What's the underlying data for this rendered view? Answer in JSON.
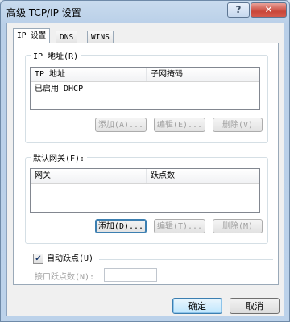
{
  "window": {
    "title": "高级 TCP/IP 设置",
    "help_label": "?",
    "close_label": "✕"
  },
  "tabs": [
    {
      "label": "IP 设置",
      "active": true
    },
    {
      "label": "DNS",
      "active": false
    },
    {
      "label": "WINS",
      "active": false
    }
  ],
  "ip_group": {
    "legend": "IP 地址(R)",
    "columns": [
      "IP 地址",
      "子网掩码"
    ],
    "rows": [
      "已启用 DHCP"
    ],
    "buttons": {
      "add": "添加(A)...",
      "edit": "编辑(E)...",
      "remove": "删除(V)"
    }
  },
  "gateway_group": {
    "legend": "默认网关(F):",
    "columns": [
      "网关",
      "跃点数"
    ],
    "rows": [],
    "buttons": {
      "add": "添加(D)...",
      "edit": "编辑(T)...",
      "remove": "删除(M)"
    }
  },
  "auto_metric": {
    "label": "自动跃点(U)",
    "checked": true,
    "check_glyph": "✔",
    "interface_label": "接口跃点数(N):",
    "interface_value": ""
  },
  "footer": {
    "ok": "确定",
    "cancel": "取消"
  }
}
